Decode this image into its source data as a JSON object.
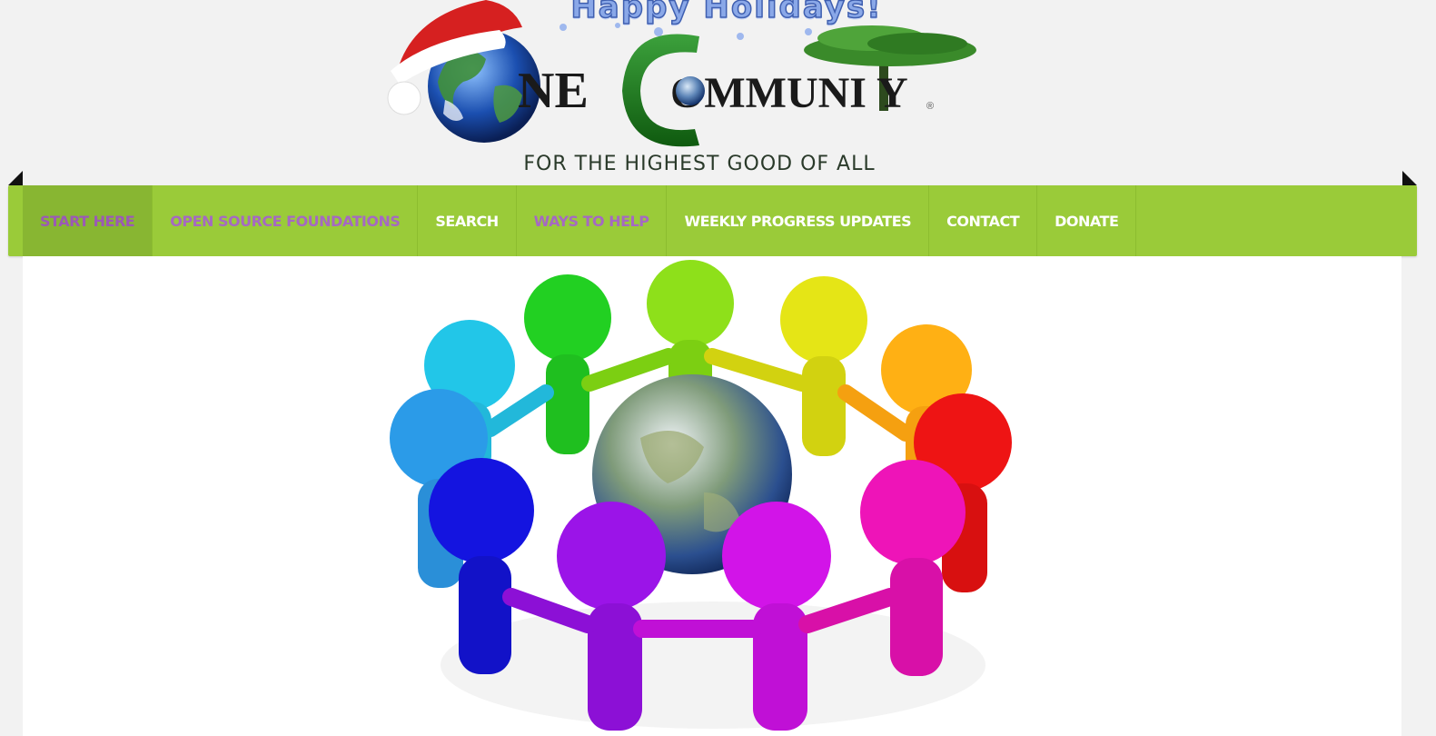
{
  "header": {
    "holiday_banner": "Happy Holidays!",
    "logo_brand": "ONE COMMUNITY",
    "logo_brand_visible": "NE   OMMUNITY",
    "tagline": "FOR THE HIGHEST GOOD OF ALL"
  },
  "nav": {
    "items": [
      {
        "label": "START HERE"
      },
      {
        "label": "OPEN SOURCE FOUNDATIONS"
      },
      {
        "label": "SEARCH"
      },
      {
        "label": "WAYS TO HELP"
      },
      {
        "label": "WEEKLY PROGRESS UPDATES"
      },
      {
        "label": "CONTACT"
      },
      {
        "label": "DONATE"
      }
    ]
  },
  "colors": {
    "nav_green": "#9acb39",
    "nav_active": "#88b632",
    "nav_purple_text": "#a569c2",
    "brand_green": "#1f7a1f",
    "page_bg": "#f2f2f2"
  },
  "icons": {
    "logo_globe": "earth-globe-icon",
    "santa_hat": "santa-hat-icon",
    "tree": "acacia-tree-icon",
    "hero": "people-circle-around-earth-illustration"
  }
}
